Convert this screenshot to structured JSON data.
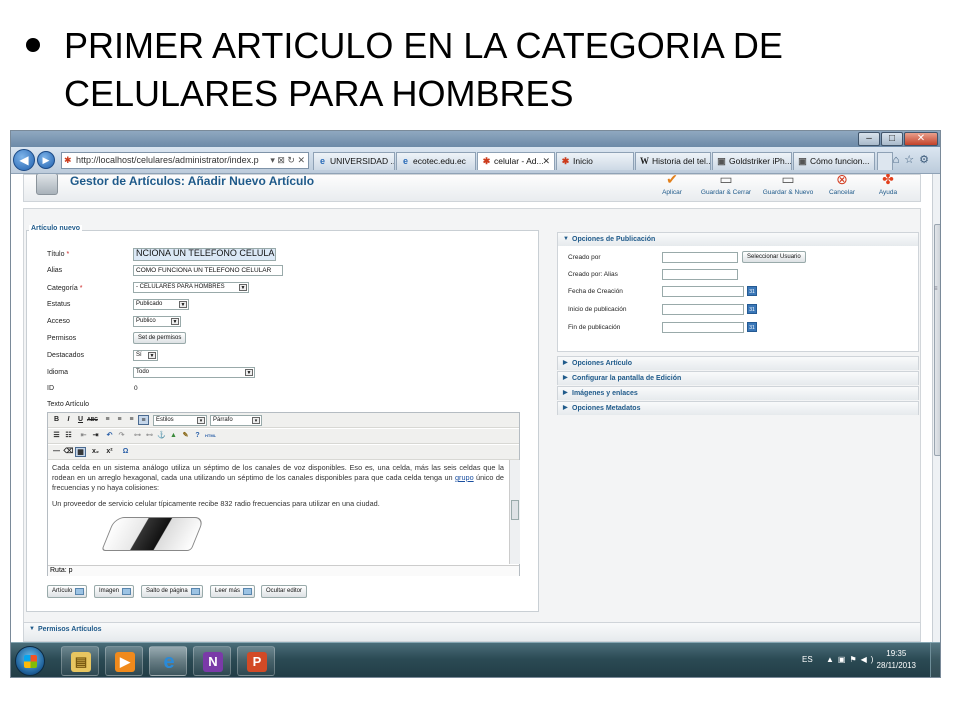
{
  "slide": {
    "title_line1": "PRIMER ARTICULO EN LA CATEGORIA DE",
    "title_line2": "CELULARES PARA HOMBRES"
  },
  "browser": {
    "address": "http://localhost/celulares/administrator/index.p",
    "tabs": [
      {
        "label": "UNIVERSIDAD ...",
        "icon": "ie-page-icon"
      },
      {
        "label": "ecotec.edu.ec",
        "icon": "ie-page-icon"
      },
      {
        "label": "celular - Ad...",
        "icon": "joomla-icon"
      },
      {
        "label": "Inicio",
        "icon": "joomla-icon"
      },
      {
        "label": "Historia del tel...",
        "icon": "wikipedia-icon"
      },
      {
        "label": "Goldstriker iPh...",
        "icon": "page-icon"
      },
      {
        "label": "Cómo funcion...",
        "icon": "page-icon"
      }
    ]
  },
  "joomla": {
    "page_title": "Gestor de Artículos: Añadir Nuevo Artículo",
    "toolbar": {
      "apply": "Aplicar",
      "save_close": "Guardar & Cerrar",
      "save_new": "Guardar & Nuevo",
      "cancel": "Cancelar",
      "help": "Ayuda"
    },
    "legend": "Artículo nuevo",
    "fields": {
      "titulo_label": "Título",
      "titulo_value": "NCIONA UN TELEFONO CELULAI",
      "alias_label": "Alias",
      "alias_value": "COMO FUNCIONA UN TELEFONO CELULAR",
      "categoria_label": "Categoría",
      "categoria_value": "- CELULARES PARA HOMBRES",
      "estatus_label": "Estatus",
      "estatus_value": "Publicado",
      "acceso_label": "Acceso",
      "acceso_value": "Publico",
      "permisos_label": "Permisos",
      "permisos_button": "Set de permisos",
      "destacados_label": "Destacados",
      "destacados_value": "Sí",
      "idioma_label": "Idioma",
      "idioma_value": "Todo",
      "id_label": "ID",
      "id_value": "0",
      "texto_label": "Texto Artículo",
      "required_mark": "*"
    },
    "editor": {
      "estilos": "Estilos",
      "parrafo": "Párrafo",
      "paragraph1_before_link": "Cada celda en un sistema análogo utiliza un séptimo de los canales de voz disponibles. Eso es, una celda, más las seis celdas que la rodean en un arreglo hexagonal, cada una utilizando un séptimo de los canales disponibles para que cada celda tenga un ",
      "paragraph1_link": "grupo",
      "paragraph1_after_link": " único de frecuencias y no haya colisiones:",
      "paragraph2": "Un proveedor de servicio celular típicamente recibe 832 radio frecuencias para utilizar en una ciudad.",
      "ruta": "Ruta: p"
    },
    "editor_buttons": {
      "articulo": "Artículo",
      "imagen": "Imagen",
      "salto": "Salto de página",
      "leer_mas": "Leer más",
      "ocultar": "Ocultar editor"
    },
    "publishing": {
      "header": "Opciones de Publicación",
      "creado_por": "Creado por",
      "seleccionar_usuario": "Seleccionar Usuario",
      "creado_por_alias": "Creado por: Alias",
      "fecha_creacion": "Fecha de Creación",
      "inicio_publicacion": "Inicio de publicación",
      "fin_publicacion": "Fin de publicación",
      "cal_label": "31"
    },
    "collapsed_panels": [
      "Opciones Artículo",
      "Configurar la pantalla de Edición",
      "Imágenes y enlaces",
      "Opciones Metadatos"
    ],
    "bottom_panel": "Permisos Artículos"
  },
  "taskbar": {
    "language": "ES",
    "time": "19:35",
    "date": "28/11/2013"
  }
}
